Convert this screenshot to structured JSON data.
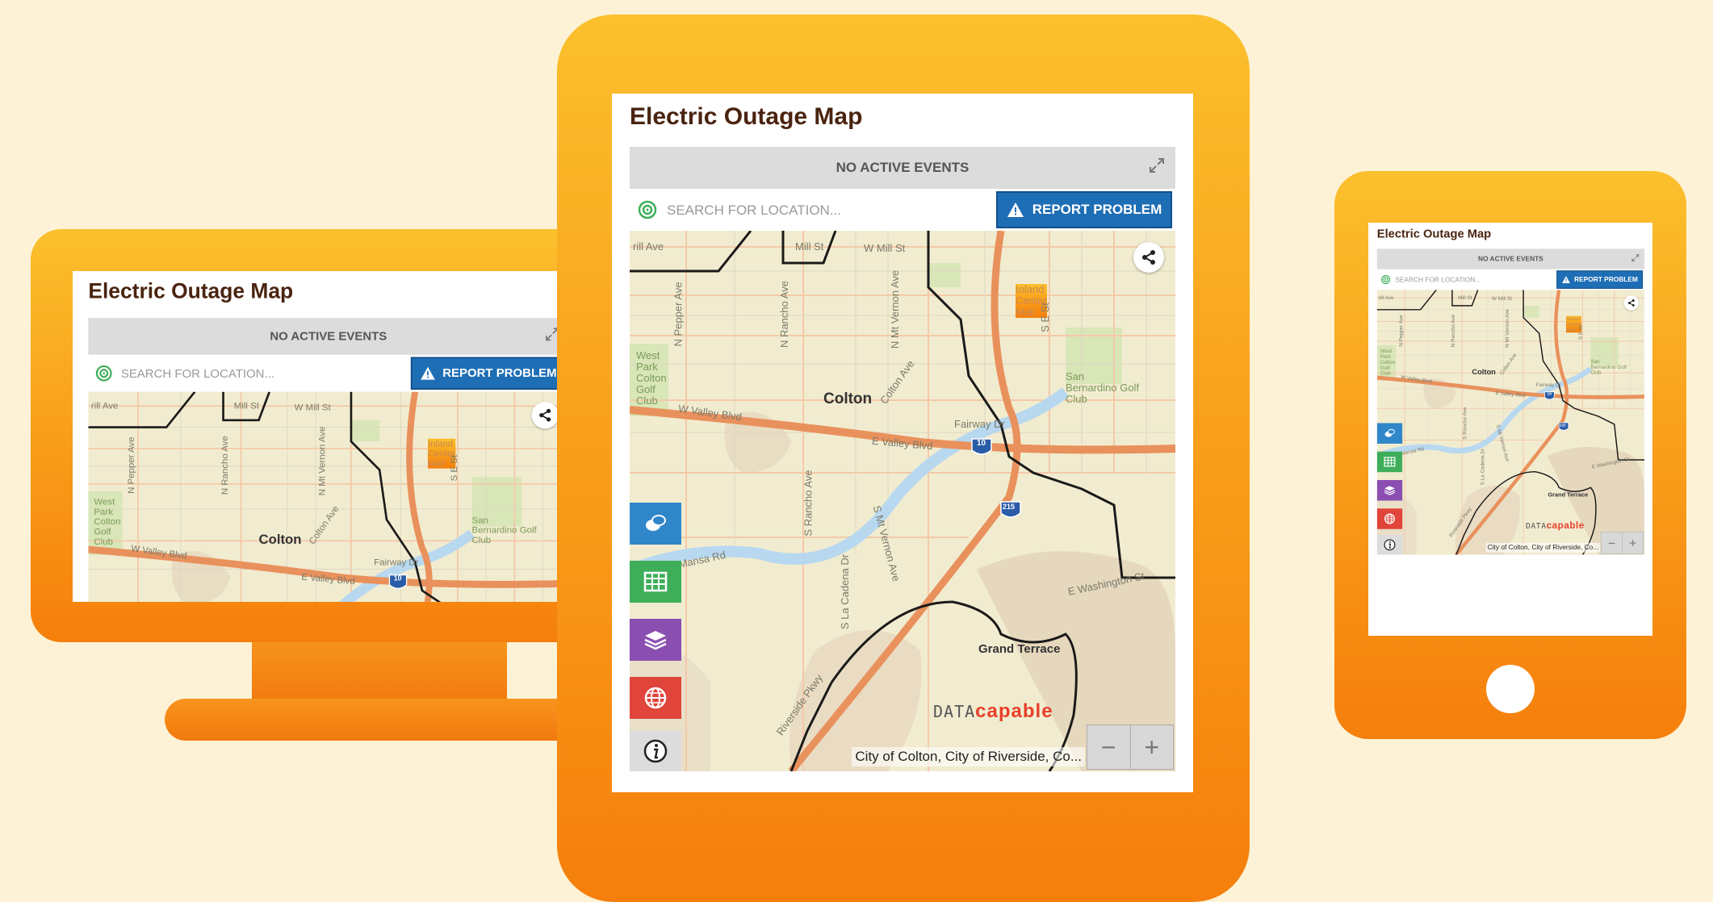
{
  "widget": {
    "title": "Electric Outage Map",
    "status_bar": "NO ACTIVE EVENTS",
    "search": {
      "placeholder": "SEARCH FOR LOCATION..."
    },
    "report_button": "REPORT PROBLEM",
    "attribution": "City of Colton, City of Riverside, Co...",
    "zoom_in": "+",
    "zoom_out": "−",
    "logo": {
      "part1": "DATA",
      "part2": "capable"
    },
    "map_labels": {
      "city": "Colton",
      "west_park": "West\nPark\nColton\nGolf\nClub",
      "san_bernardino": "San\nBernardino Golf\nClub",
      "inland_center": "Inland\nCenter\nMall",
      "grand_terrace": "Grand Terrace",
      "mill_st": "Mill St",
      "w_mill_st": "W Mill St",
      "rill_ave": "rill Ave",
      "n_pepper_ave": "N Pepper Ave",
      "n_rancho_ave": "N Rancho Ave",
      "n_mt_vernon_ave": "N Mt Vernon Ave",
      "colton_ave": "Colton Ave",
      "fairway_dr": "Fairway Dr",
      "w_valley_blvd": "W Valley Blvd",
      "e_valley_blvd": "E Valley Blvd",
      "s_rancho_ave": "S Rancho Ave",
      "s_mt_vernon_ave": "S Mt Vernon Ave",
      "s_la_cadena_dr": "S La Cadena Dr",
      "agua_mansa_rd": "Mansa Rd",
      "e_washington_st": "E Washington St",
      "riverside_pkwy": "Riverside Pkwy",
      "s_e_st": "S E St",
      "i10": "10",
      "i215": "215"
    }
  },
  "colors": {
    "device_orange": "#f7941d",
    "title_brown": "#4a2410",
    "report_blue": "#1e6eb5",
    "legend_blue": "#2f86c9",
    "table_green": "#3fae5a",
    "layers_purple": "#8a4fb0",
    "basemap_red": "#e0443a",
    "background": "#fdf2d6"
  },
  "icons": [
    "expand-icon",
    "target-icon",
    "warning-icon",
    "share-icon",
    "legend-icon",
    "table-icon",
    "layers-icon",
    "globe-icon",
    "info-icon"
  ]
}
